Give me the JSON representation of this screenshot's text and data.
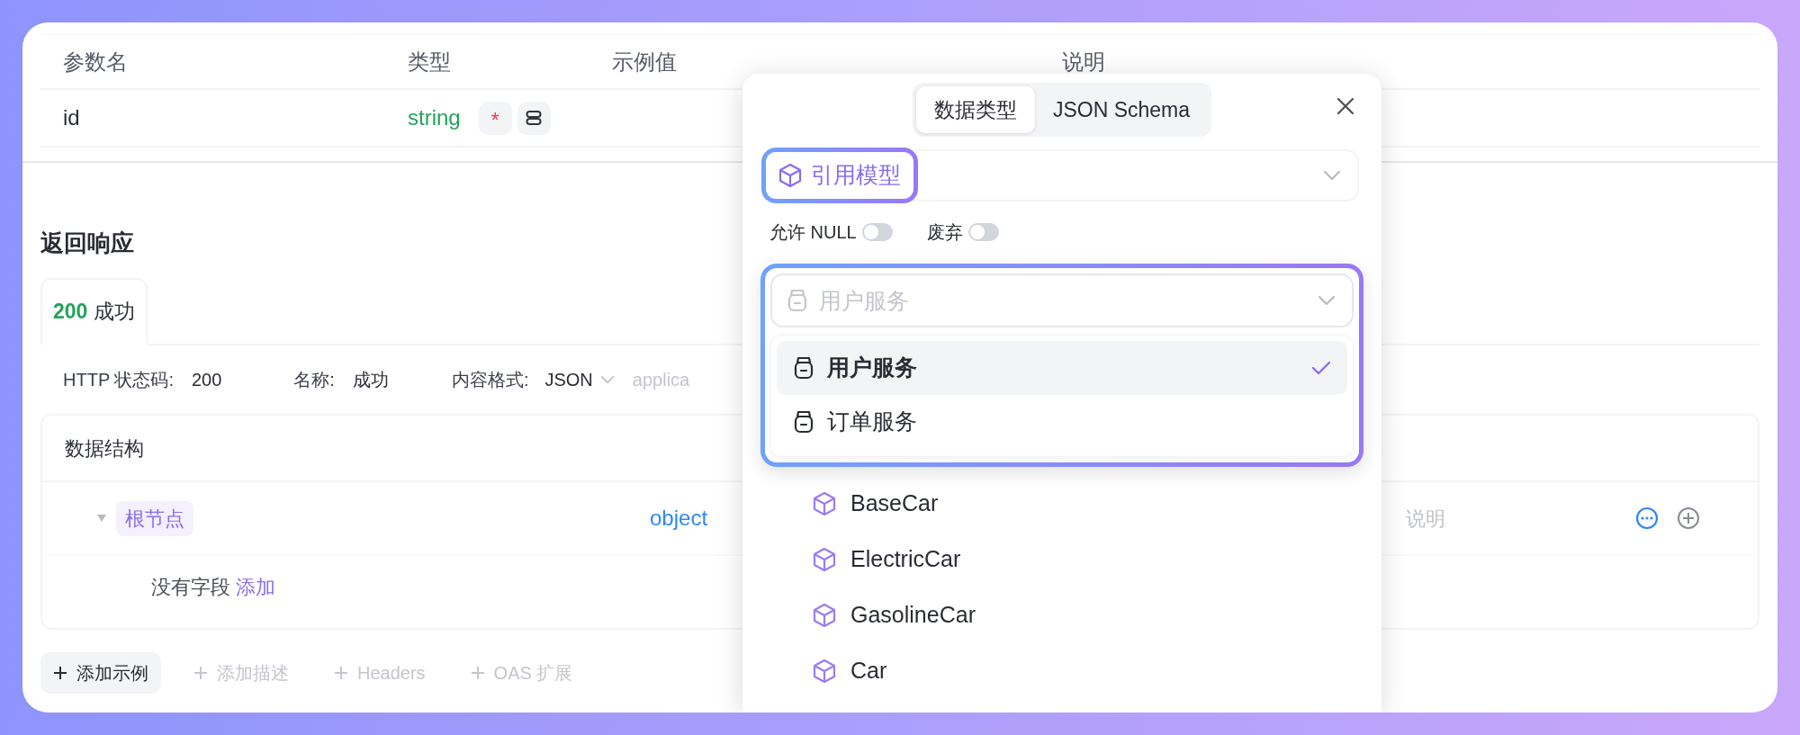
{
  "params_table": {
    "columns": [
      "参数名",
      "类型",
      "示例值",
      "说明"
    ],
    "rows": [
      {
        "name": "id",
        "type": "string",
        "required_mark": "*"
      }
    ]
  },
  "response": {
    "title": "返回响应",
    "tabs": [
      {
        "code": "200",
        "label": "成功",
        "selected": true
      }
    ],
    "meta": [
      {
        "label": "HTTP 状态码:",
        "value": "200"
      },
      {
        "label": "名称:",
        "value": "成功"
      },
      {
        "label": "内容格式:",
        "value": "JSON",
        "kind": "dropdown"
      }
    ],
    "media_type": "applica"
  },
  "schema": {
    "title": "数据结构",
    "root": {
      "label": "根节点",
      "type": "object",
      "description_placeholder": "说明",
      "expanded": true
    },
    "empty_text": "没有字段",
    "add_link": "添加"
  },
  "actions": [
    {
      "label": "添加示例",
      "disabled": false
    },
    {
      "label": "添加描述",
      "disabled": true
    },
    {
      "label": "Headers",
      "disabled": true
    },
    {
      "label": "OAS 扩展",
      "disabled": true
    }
  ],
  "popover": {
    "tabs": [
      {
        "label": "数据类型",
        "selected": true
      },
      {
        "label": "JSON Schema",
        "selected": false
      }
    ],
    "type_chip": "引用模型",
    "toggles": [
      {
        "label": "允许 NULL",
        "on": false
      },
      {
        "label": "废弃",
        "on": false
      }
    ],
    "service_select": {
      "placeholder": "用户服务"
    },
    "service_options": [
      {
        "label": "用户服务",
        "selected": true
      },
      {
        "label": "订单服务",
        "selected": false
      }
    ],
    "models": [
      "BaseCar",
      "ElectricCar",
      "GasolineCar",
      "Car"
    ]
  }
}
